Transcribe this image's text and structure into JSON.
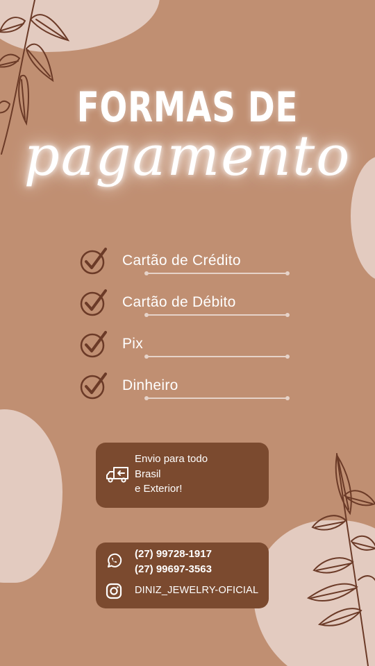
{
  "title": {
    "line1": "FORMAS DE",
    "line2": "pagamento"
  },
  "payment_methods": [
    {
      "label": "Cartão de Crédito",
      "icon": "check-circle-icon"
    },
    {
      "label": "Cartão de Débito",
      "icon": "check-circle-icon"
    },
    {
      "label": "Pix",
      "icon": "check-circle-icon"
    },
    {
      "label": "Dinheiro",
      "icon": "check-circle-icon"
    }
  ],
  "shipping": {
    "icon": "delivery-truck-icon",
    "lines": [
      "Envio para todo",
      "Brasil",
      "e Exterior!"
    ]
  },
  "contact": {
    "whatsapp_icon": "whatsapp-icon",
    "phones": [
      "(27) 99728-1917",
      "(27) 99697-3563"
    ],
    "instagram_icon": "instagram-icon",
    "instagram": "DINIZ_JEWELRY-OFICIAL"
  },
  "colors": {
    "background": "#c08f72",
    "blob": "#e3cbc0",
    "card": "#7b4a2f",
    "leaf": "#6b3a27",
    "text": "#ffffff"
  }
}
